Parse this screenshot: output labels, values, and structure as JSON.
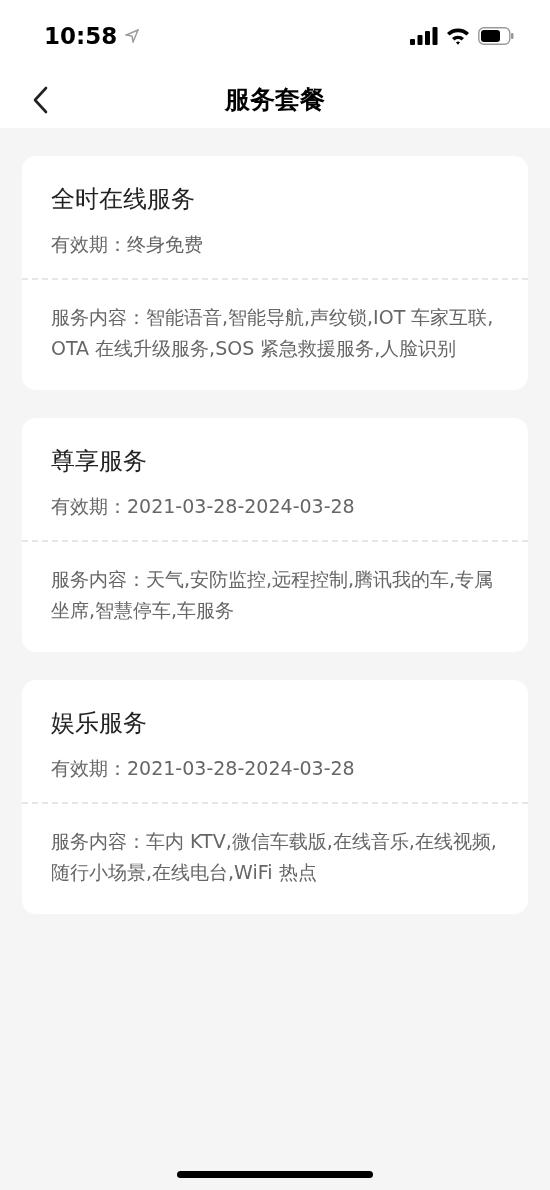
{
  "status_bar": {
    "time": "10:58"
  },
  "nav": {
    "title": "服务套餐"
  },
  "packages": [
    {
      "name": "全时在线服务",
      "validity": "有效期：终身免费",
      "content": "服务内容：智能语音,智能导航,声纹锁,IOT 车家互联,OTA 在线升级服务,SOS 紧急救援服务,人脸识别"
    },
    {
      "name": "尊享服务",
      "validity": "有效期：2021-03-28-2024-03-28",
      "content": "服务内容：天气,安防监控,远程控制,腾讯我的车,专属坐席,智慧停车,车服务"
    },
    {
      "name": "娱乐服务",
      "validity": "有效期：2021-03-28-2024-03-28",
      "content": "服务内容：车内 KTV,微信车载版,在线音乐,在线视频,随行小场景,在线电台,WiFi 热点"
    }
  ]
}
